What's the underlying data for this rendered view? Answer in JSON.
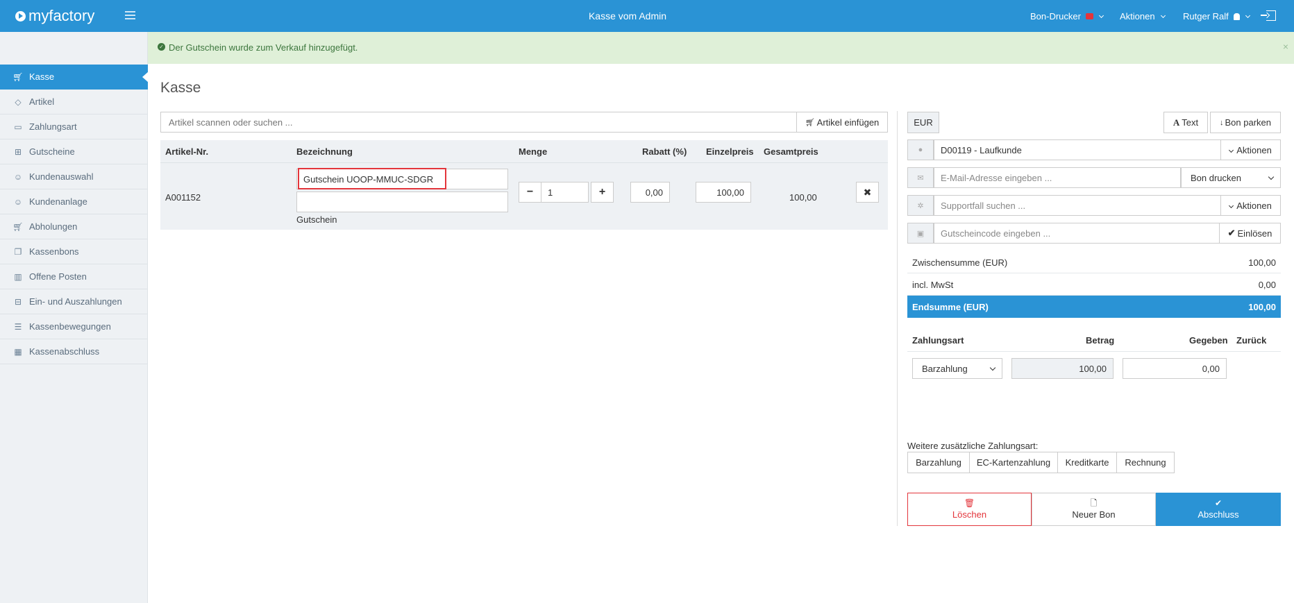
{
  "header": {
    "logo_text": "myfactory",
    "title": "Kasse vom Admin",
    "menu": [
      {
        "label": "Bon-Drucker",
        "icon": "printer-icon"
      },
      {
        "label": "Aktionen"
      },
      {
        "label": "Rutger Ralf",
        "icon": "user-icon"
      }
    ]
  },
  "sidebar": {
    "items": [
      {
        "label": "Kasse",
        "icon": "cart-icon",
        "active": true
      },
      {
        "label": "Artikel",
        "icon": "tag-icon"
      },
      {
        "label": "Zahlungsart",
        "icon": "wallet-icon"
      },
      {
        "label": "Gutscheine",
        "icon": "gift-icon"
      },
      {
        "label": "Kundenauswahl",
        "icon": "users-icon"
      },
      {
        "label": "Kundenanlage",
        "icon": "user-plus-icon"
      },
      {
        "label": "Abholungen",
        "icon": "cart-pickup-icon"
      },
      {
        "label": "Kassenbons",
        "icon": "receipts-icon"
      },
      {
        "label": "Offene Posten",
        "icon": "book-icon"
      },
      {
        "label": "Ein- und Auszahlungen",
        "icon": "inbox-icon"
      },
      {
        "label": "Kassenbewegungen",
        "icon": "list-icon"
      },
      {
        "label": "Kassenabschluss",
        "icon": "table-icon"
      }
    ]
  },
  "alert": {
    "message": "Der Gutschein wurde zum Verkauf hinzugefügt.",
    "close": "×"
  },
  "main": {
    "title": "Kasse",
    "search_placeholder": "Artikel scannen oder suchen ...",
    "insert_button": "Artikel einfügen",
    "columns": [
      "Artikel-Nr.",
      "Bezeichnung",
      "Menge",
      "Rabatt (%)",
      "Einzelpreis",
      "Gesamtpreis"
    ],
    "row": {
      "article_no": "A001152",
      "name": "Gutschein UOOP-MMUC-SDGR",
      "name2": "",
      "type": "Gutschein",
      "quantity": "1",
      "discount": "0,00",
      "unit_price": "100,00",
      "total": "100,00"
    }
  },
  "right": {
    "currency": "EUR",
    "text_button": "Text",
    "park_button": "Bon parken",
    "customer": "D00119 - Laufkunde",
    "customer_actions": "Aktionen",
    "email_placeholder": "E-Mail-Adresse eingeben ...",
    "print_select": "Bon drucken",
    "support_placeholder": "Supportfall suchen ...",
    "support_actions": "Aktionen",
    "voucher_placeholder": "Gutscheincode eingeben ...",
    "redeem_button": "Einlösen",
    "subtotal_label": "Zwischensumme (EUR)",
    "subtotal_value": "100,00",
    "tax_label": "incl. MwSt",
    "tax_value": "0,00",
    "total_label": "Endsumme (EUR)",
    "total_value": "100,00",
    "payment_headers": [
      "Zahlungsart",
      "Betrag",
      "Gegeben",
      "Zurück"
    ],
    "payment": {
      "method": "Barzahlung",
      "amount": "100,00",
      "given": "0,00"
    },
    "extra_label": "Weitere zusätzliche Zahlungsart:",
    "extra_methods": [
      "Barzahlung",
      "EC-Kartenzahlung",
      "Kreditkarte",
      "Rechnung"
    ],
    "delete_button": "Löschen",
    "new_button": "Neuer Bon",
    "finish_button": "Abschluss"
  },
  "colors": {
    "primary": "#2a93d5",
    "success_bg": "#dff0d8",
    "danger": "#e3353b"
  }
}
